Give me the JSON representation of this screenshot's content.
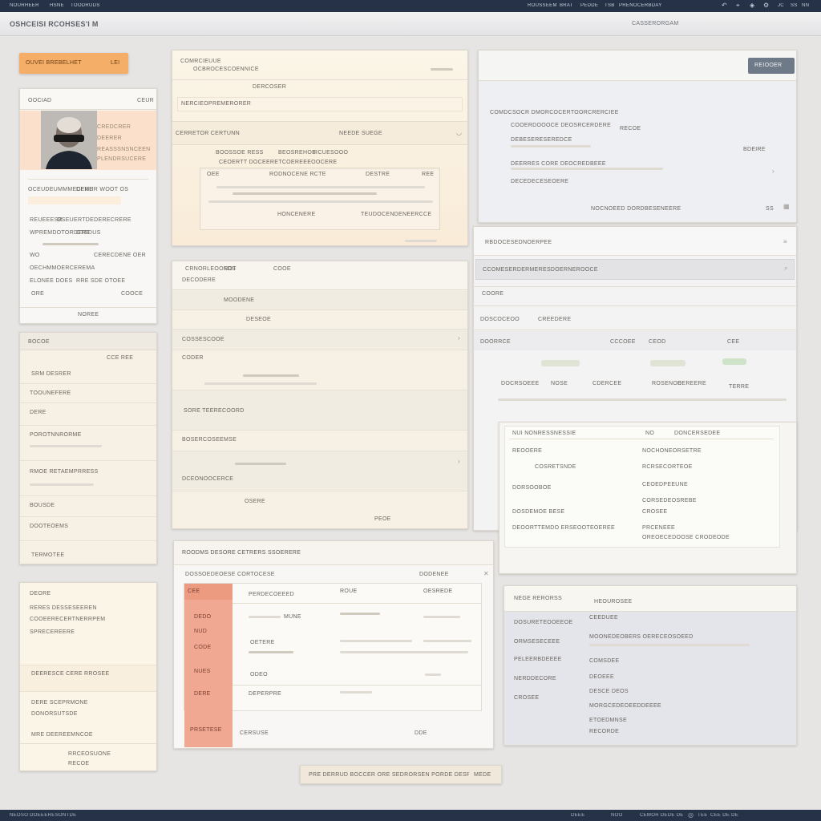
{
  "topbar": {
    "left_items": [
      "NOURHEER",
      "HSNE",
      "TOODRUDS"
    ],
    "right_items": [
      "ROUSSEEM",
      "BRAT",
      "PEDDE",
      "TSB",
      "PRENOCERBDAY"
    ],
    "right_controls": [
      "ƧS",
      "JC",
      "SS",
      "NN"
    ]
  },
  "header": {
    "title": "OSHCEISI RCOHSES'I M",
    "right_text": "CASSERORGAM"
  },
  "accent_button": {
    "label": "OUVEI BREBELHET",
    "badge": "LEI"
  },
  "profile_card": {
    "header_label": "OOCIAD",
    "header_right": "CEUR",
    "lines": [
      "CREDCRER",
      "DEERER",
      "REASSSNSNCEEN",
      "PLENDRSUCERE"
    ],
    "fields": [
      {
        "label": "OCEUDEUMMMECERE",
        "value": "DEMUR WOOT OS"
      },
      {
        "label": "REUEEESR",
        "value": "OSEUERTDEDERECRERE"
      },
      {
        "label": "WPREMDOTORDERE",
        "value": "CTEDUS"
      },
      {
        "label": "WO",
        "value": "CERECDENE OER"
      },
      {
        "label": "OECHMMOERCEREMA",
        "value": ""
      },
      {
        "label": "ELONEE DOES",
        "value": "RRE SDE OTOEE"
      },
      {
        "label": "ORE",
        "value": "COOCE"
      }
    ],
    "footer": "NOREE"
  },
  "left_list": {
    "header": "BOCOE",
    "header_right": "CCE REE",
    "items": [
      "SRM DESRER",
      "TOOUNEFERE",
      "DERE",
      "POROTNNRORME",
      "RMOE RETAEMPRRESS",
      "BOUSDE",
      "DOOTEOEMS",
      "TERMOTEE"
    ]
  },
  "left_card3": {
    "header": "DEORE",
    "lines": [
      "RERES DESSESEEREN",
      "COOEERECERTNERRPEM",
      "SPRECEREERE"
    ],
    "mid": "DEERESCE CERE RROSEE",
    "items": [
      "DERE SCEPRMONE",
      "DONORSUTSDE",
      "MRE DEEREEMNCOE"
    ],
    "footer": [
      "RRCEOSUONE",
      "RECOE"
    ]
  },
  "center_form": {
    "title": "COMRCIEUUE",
    "subtitle": "OCBROCESCOENNICE",
    "fields": [
      "DERCOSER",
      "NERCIEOPREMERORER"
    ],
    "section": "CERRETOR CERTUNN",
    "section_right": "NEEDE SUEGE",
    "labels": [
      "BOOSSOE RESS",
      "BEOSREHOE",
      "RCUESOOO"
    ],
    "desc": "CEOERTT DOCEERETCOEREEEOOCERE",
    "inner_headers": [
      "OEE",
      "RODNOCENE RCTE",
      "DESTRE",
      "REE"
    ],
    "inner_footer": [
      "HONCENERE",
      "TEUDOCENDENEERCCE"
    ]
  },
  "center_list": {
    "header": "CRNORLEOOEDS",
    "header_mid": "NOT",
    "header_right": "COOE",
    "sub": "DECODERE",
    "rows": [
      "MOODENE",
      "DESEOE",
      "COSSESCOOE",
      "CODER",
      "SORE TEERECOORD",
      "BOSERCOSEEMSE"
    ],
    "footer": [
      "DCEONOOCERCE",
      "OSERE",
      "PEOE"
    ]
  },
  "center_table": {
    "title": "ROODMS DESORE CETRERS SSOERERE",
    "toolbar": "DOSSOEDEOESE CORTOCESE",
    "toolbar_right": "DODENEE",
    "sidebar_items": [
      "CEE",
      "DEDO",
      "NUD",
      "CODE",
      "NUES",
      "DERE",
      "PRSETESE"
    ],
    "col_headers": [
      "PERDECOEEED",
      "ROUE",
      "OESREDE"
    ],
    "rows": [
      "MUNE",
      "OETERE",
      "ODEO",
      "DEPERPRE",
      "CERSUSE",
      "DDE"
    ]
  },
  "center_bottom_bar": {
    "label": "PRE DERRUD BOCCER ORE SEDRORSEN PORDE DESR",
    "right": "MEDE"
  },
  "right_top": {
    "button": "REIOOER",
    "lines": [
      "COMDCSOCR DMORCOCERTOORCRERCIEE",
      "COOERDOOOCE DEOSRCERDERE",
      "RECOE",
      "DEBESERESEREDCE",
      "DEERRES CORE DEOCREDBEEE",
      "DECEDECESEOERE"
    ],
    "badge": "BDEIRE",
    "footer": "NOCNOEED DORDBESENEERE",
    "footer_right": "SS"
  },
  "right_mid": {
    "title": "RBDOCESEDNOERPEE",
    "search": "CCOMESERDERMERESDOERNEROOCE",
    "labels": [
      "COORE",
      "DOSCOCEOO",
      "CREEDERE"
    ],
    "cols": [
      "DOORRCE",
      "CCCOEE",
      "CEOD",
      "CEE"
    ],
    "values": [
      "DOCRSOEEE",
      "NOSE",
      "CDERCEE",
      "ROSENOE",
      "DEREERE",
      "TERRE"
    ]
  },
  "right_card": {
    "title": "NUI NONRESSNESSIE",
    "title_mid": "NO",
    "title_right": "DONCERSEDEE",
    "left": [
      "REOOERE",
      "COSRETSNDE",
      "DORSOOBOE",
      "DOSDEMOE BESE",
      "DEOORTTEMDO ERSEOOTEOEREE"
    ],
    "right": [
      "NOCHONEORSETRE",
      "RCRSECORTEOE",
      "CEOEDPEEUNE",
      "CORSEDEOSREBE",
      "CROSEE",
      "PRCENEEE",
      "OREOECEDOOSE CRODEODE"
    ]
  },
  "right_bottom": {
    "header": "NEGE RERORSS",
    "header_right": "HEOUROSEE",
    "left": [
      "DOSURETEOOEEOE",
      "ORMSESECEEE",
      "PELEERBDEEEE",
      "NERDDECORE",
      "CROSEE"
    ],
    "right": [
      "CEEDUEE",
      "MOONEDEOBERS OERECEOSOEED",
      "COMSDEE",
      "DEOEEE",
      "DESCE DEOS",
      "MORGCEDEOEEDDEEEE",
      "ETOEDMNSE",
      "RECORDE"
    ]
  },
  "footerbar": {
    "left": "NEOSO DOEEERESONTDE",
    "right": [
      "DEEE",
      "NOO",
      "CEMOR DEDE DE",
      "TEE",
      "CEE DE DE"
    ]
  },
  "colors": {
    "accent": "#f5ae68",
    "navy": "#253247",
    "salmon": "#f0a893",
    "cream": "#fbf5e8"
  }
}
